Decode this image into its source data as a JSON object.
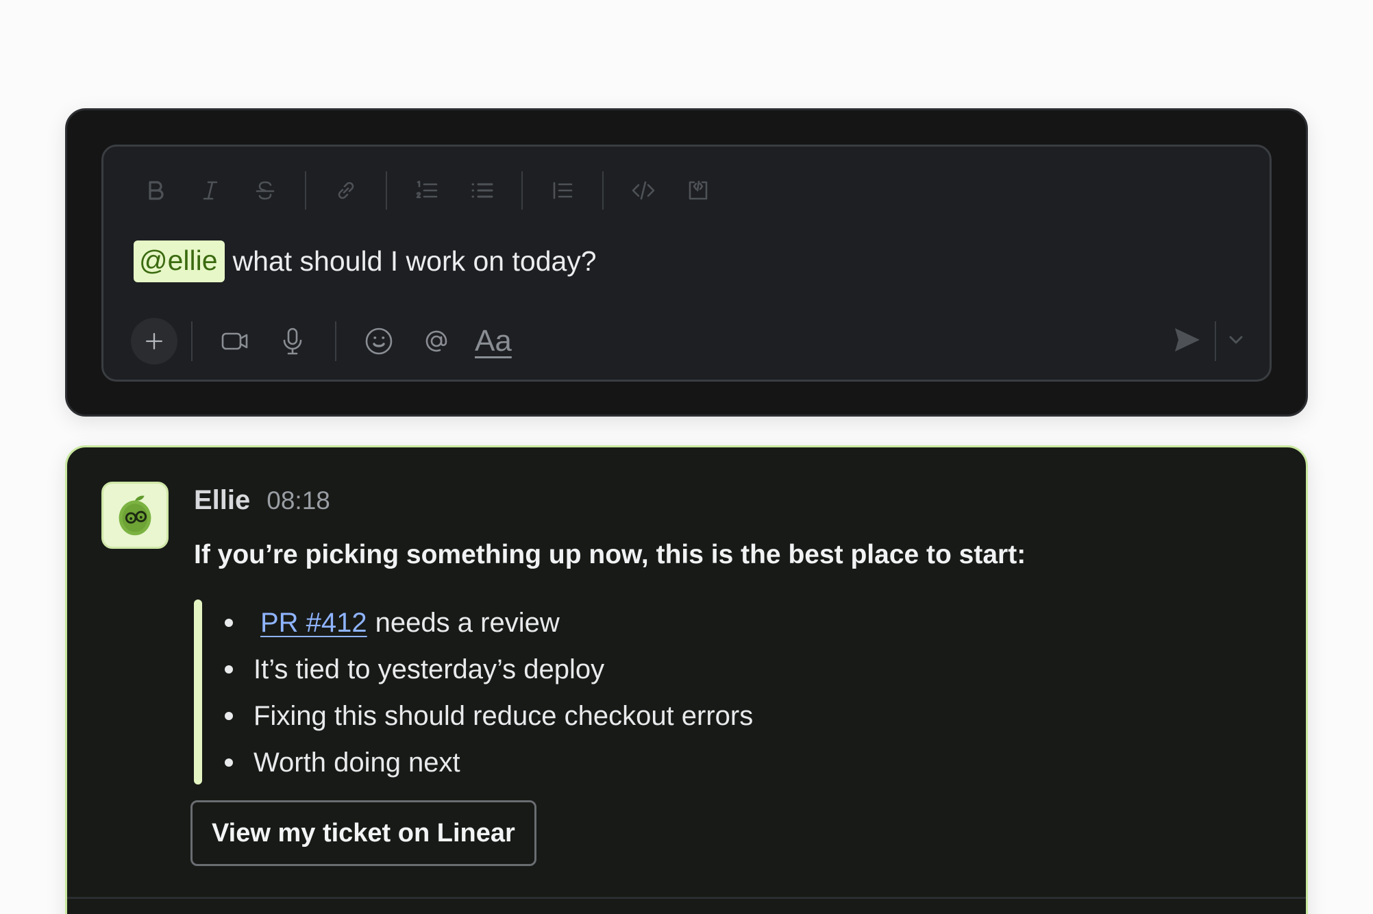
{
  "composer": {
    "toolbar": {
      "bold_icon": "bold-icon",
      "italic_icon": "italic-icon",
      "strike_icon": "strikethrough-icon",
      "link_icon": "link-icon",
      "ordered_list_icon": "ordered-list-icon",
      "bullet_list_icon": "bullet-list-icon",
      "blockquote_icon": "blockquote-icon",
      "code_icon": "code-icon",
      "code_block_icon": "code-block-icon"
    },
    "mention": "@ellie",
    "message_text": "what should I work on today?",
    "format_label": "Aa",
    "bottom_icons": [
      "plus-icon",
      "video-icon",
      "microphone-icon",
      "emoji-icon",
      "at-icon",
      "send-icon",
      "chevron-down-icon"
    ]
  },
  "reply": {
    "sender": "Ellie",
    "time": "08:18",
    "headline": "If you’re picking something up now, this is the best place to start:",
    "bullets": {
      "b0_link": "PR #412",
      "b0_text": "needs a review",
      "b1": "It’s tied to yesterday’s deploy",
      "b2": "Fixing this should reduce checkout errors",
      "b3": "Worth doing next"
    },
    "button_label": "View my ticket on Linear"
  },
  "colors": {
    "card_bg": "#151515",
    "composer_bg": "#1d1f22",
    "mention_bg": "#e7f7c7",
    "mention_text": "#3b6a10",
    "reply_border": "#c9e8a0",
    "quote_bar": "#e4f5c3",
    "link": "#8fb4ff"
  }
}
